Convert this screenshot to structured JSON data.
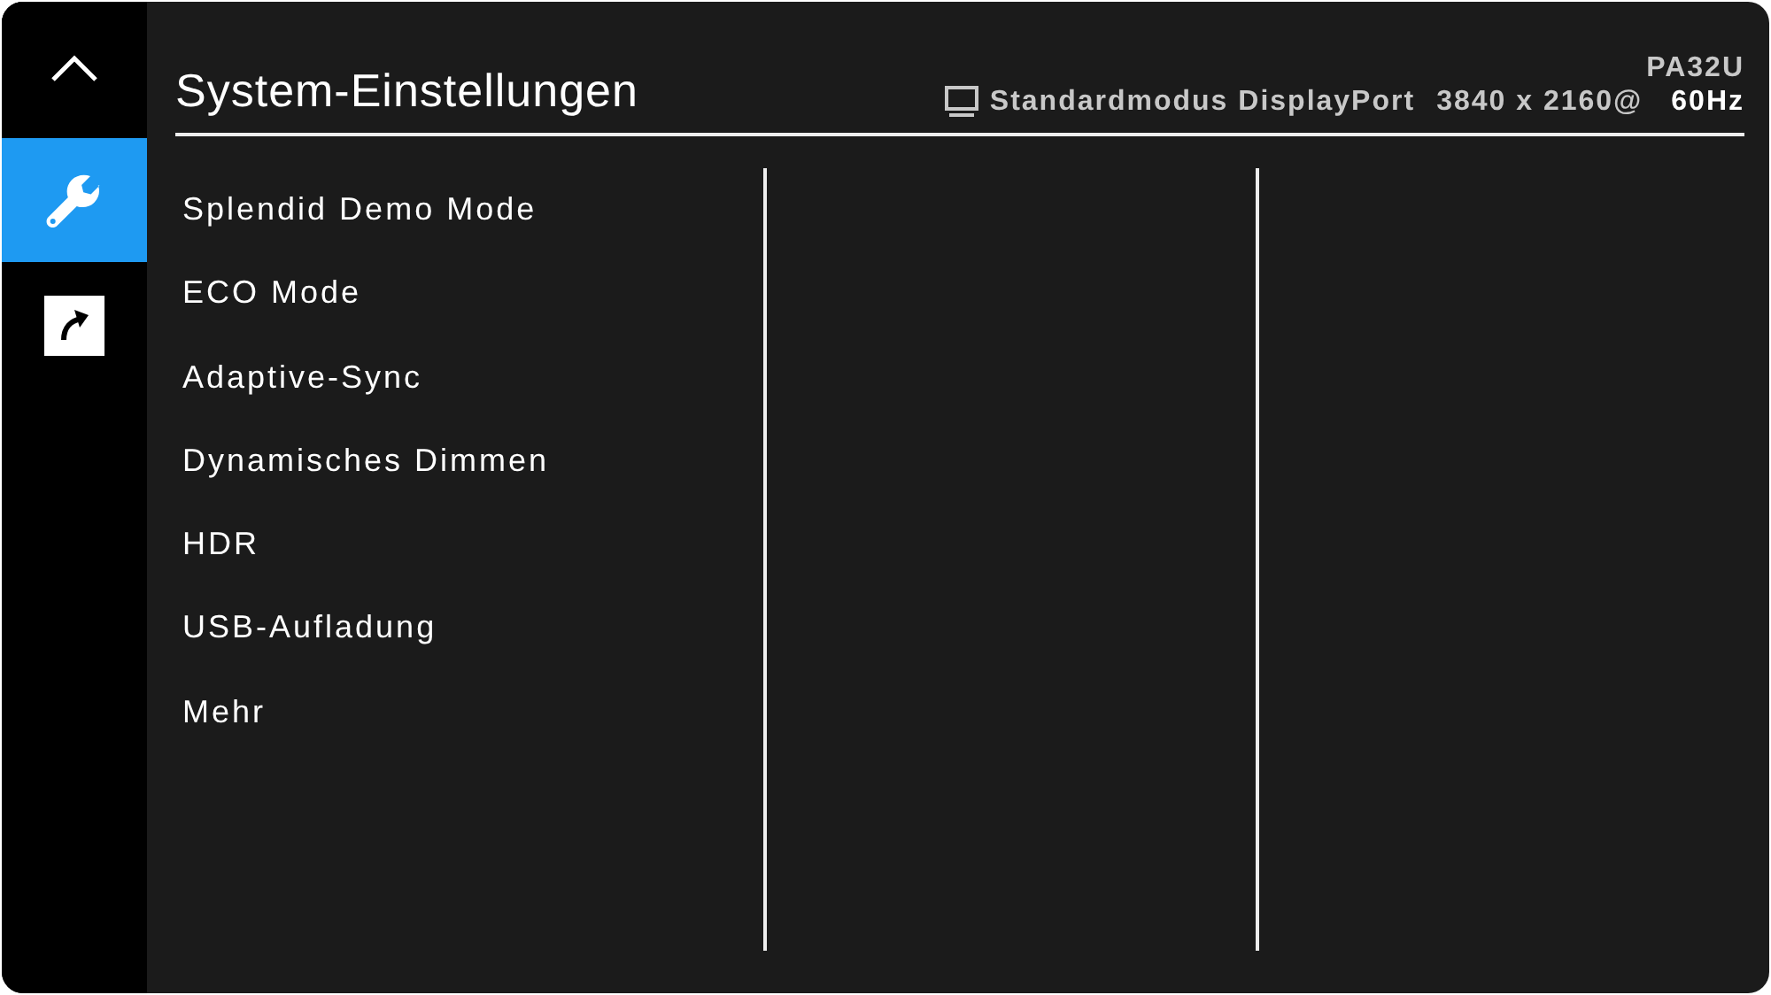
{
  "sidebar": {
    "tabs": [
      {
        "kind": "settings",
        "selected": true
      },
      {
        "kind": "shortcut",
        "selected": false
      }
    ]
  },
  "header": {
    "title": "System-Einstellungen",
    "model": "PA32U",
    "mode": "Standardmodus DisplayPort",
    "resolution": "3840 x 2160@",
    "refresh": "60Hz"
  },
  "menu": {
    "items": [
      {
        "label": "Splendid Demo Mode",
        "selected": false
      },
      {
        "label": "ECO Mode",
        "selected": false
      },
      {
        "label": "Adaptive-Sync",
        "selected": false
      },
      {
        "label": "Dynamisches Dimmen",
        "selected": false
      },
      {
        "label": "HDR",
        "selected": false
      },
      {
        "label": "USB-Aufladung",
        "selected": false
      },
      {
        "label": "Mehr",
        "selected": false
      }
    ]
  }
}
